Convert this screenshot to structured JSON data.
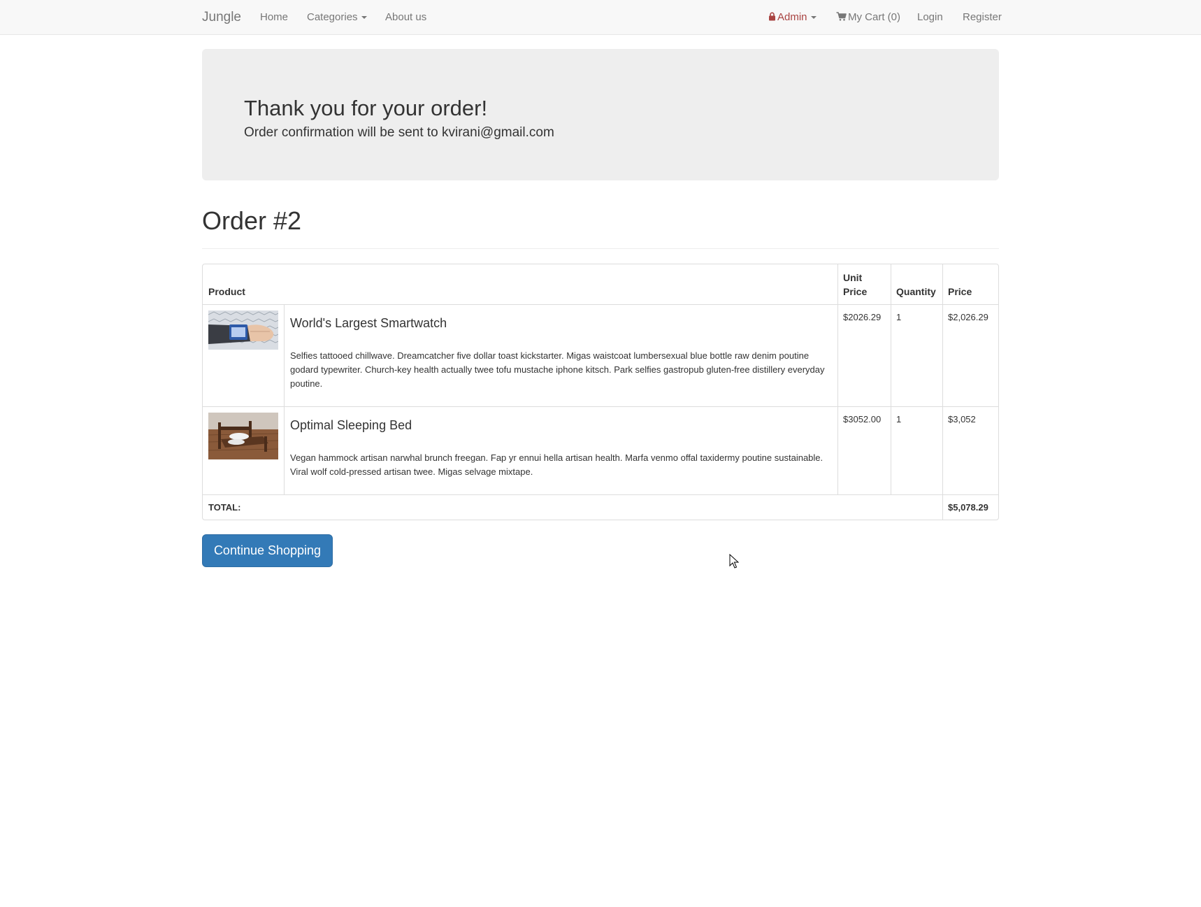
{
  "navbar": {
    "brand": "Jungle",
    "home": "Home",
    "categories": "Categories",
    "about": "About us",
    "admin": "Admin",
    "cart": "My Cart (0)",
    "login": "Login",
    "register": "Register"
  },
  "jumbotron": {
    "title": "Thank you for your order!",
    "subtitle": "Order confirmation will be sent to kvirani@gmail.com"
  },
  "order": {
    "title": "Order #2",
    "headers": {
      "product": "Product",
      "unit_price": "Unit Price",
      "quantity": "Quantity",
      "price": "Price"
    },
    "items": [
      {
        "name": "World's Largest Smartwatch",
        "description": "Selfies tattooed chillwave. Dreamcatcher five dollar toast kickstarter. Migas waistcoat lumbersexual blue bottle raw denim poutine godard typewriter. Church-key health actually twee tofu mustache iphone kitsch. Park selfies gastropub gluten-free distillery everyday poutine.",
        "unit_price": "$2026.29",
        "quantity": "1",
        "price": "$2,026.29"
      },
      {
        "name": "Optimal Sleeping Bed",
        "description": "Vegan hammock artisan narwhal brunch freegan. Fap yr ennui hella artisan health. Marfa venmo offal taxidermy poutine sustainable. Viral wolf cold-pressed artisan twee. Migas selvage mixtape.",
        "unit_price": "$3052.00",
        "quantity": "1",
        "price": "$3,052"
      }
    ],
    "total_label": "TOTAL:",
    "total_value": "$5,078.29"
  },
  "actions": {
    "continue_shopping": "Continue Shopping"
  },
  "colors": {
    "primary": "#337ab7",
    "admin": "#a94442",
    "navbar_bg": "#f8f8f8",
    "jumbotron_bg": "#eeeeee"
  }
}
